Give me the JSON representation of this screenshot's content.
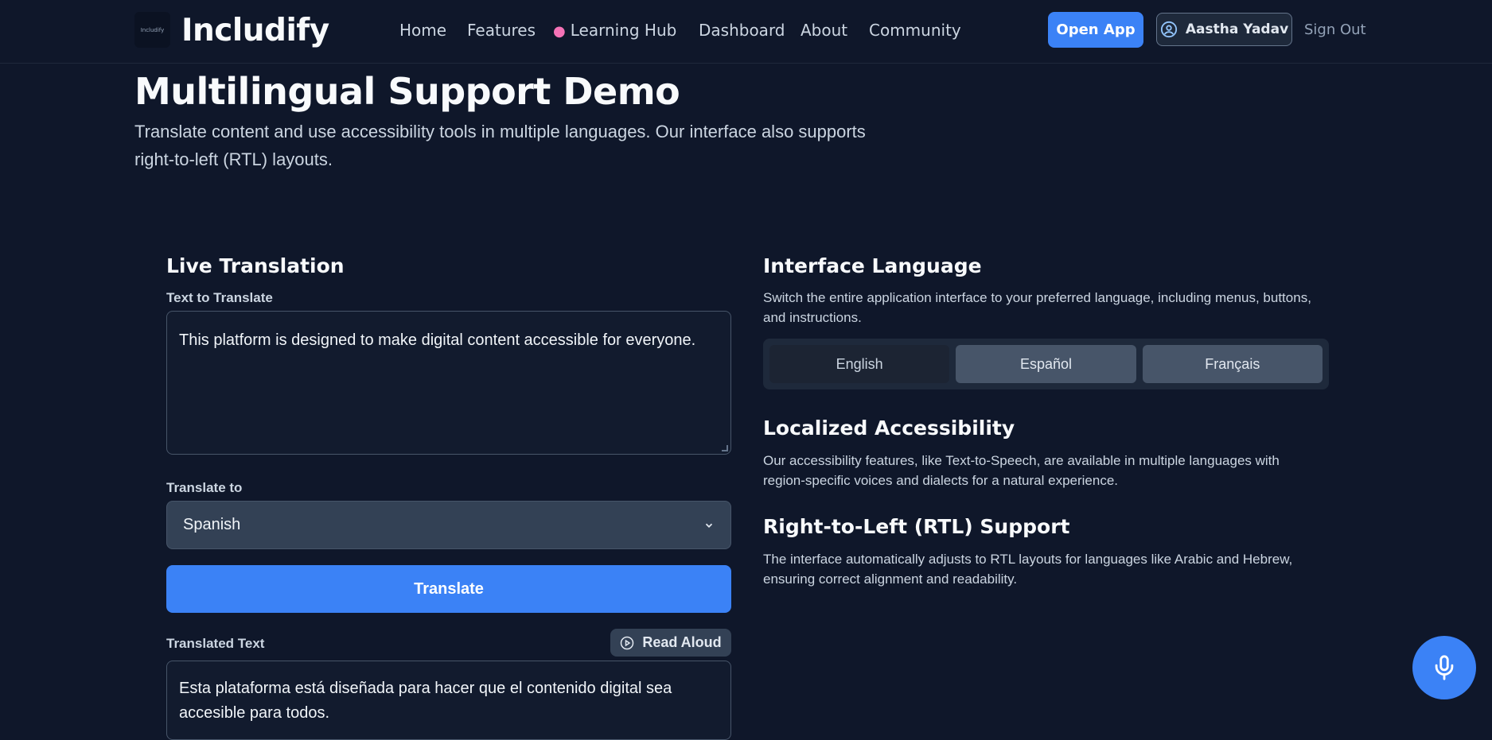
{
  "header": {
    "logo_text": "Includify",
    "brand": "Includify",
    "nav": [
      {
        "label": "Home"
      },
      {
        "label": "Features"
      },
      {
        "label": "Learning Hub",
        "icon": "brain-icon"
      },
      {
        "label": "Dashboard"
      },
      {
        "label": "About"
      },
      {
        "label": "Community"
      }
    ],
    "open_app": "Open App",
    "user_name": "Aastha Yadav",
    "sign_out": "Sign Out"
  },
  "page": {
    "title": "Multilingual Support Demo",
    "subtitle": "Translate content and use accessibility tools in multiple languages. Our interface also supports right-to-left (RTL) layouts."
  },
  "translation": {
    "heading": "Live Translation",
    "input_label": "Text to Translate",
    "input_value": "This platform is designed to make digital content accessible for everyone.",
    "target_label": "Translate to",
    "target_value": "Spanish",
    "translate_button": "Translate",
    "output_label": "Translated Text",
    "read_aloud": "Read Aloud",
    "output_value": "Esta plataforma está diseñada para hacer que el contenido digital sea accesible para todos."
  },
  "interface_language": {
    "heading": "Interface Language",
    "description": "Switch the entire application interface to your preferred language, including menus, buttons, and instructions.",
    "options": [
      "English",
      "Español",
      "Français"
    ],
    "selected": "English"
  },
  "localized": {
    "heading": "Localized Accessibility",
    "description": "Our accessibility features, like Text-to-Speech, are available in multiple languages with region-specific voices and dialects for a natural experience."
  },
  "rtl": {
    "heading": "Right-to-Left (RTL) Support",
    "description": "The interface automatically adjusts to RTL layouts for languages like Arabic and Hebrew, ensuring correct alignment and readability."
  },
  "colors": {
    "background": "#0f172a",
    "accent": "#3b82f6",
    "learning_hub_icon": "#f472b6"
  }
}
